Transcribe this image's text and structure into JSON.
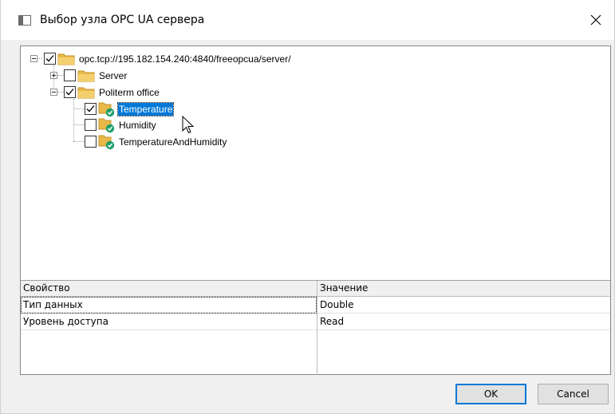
{
  "window": {
    "title": "Выбор узла OPC UA сервера"
  },
  "tree": {
    "root": {
      "label": "opc.tcp://195.182.154.240:4840/freeopcua/server/",
      "checked": true,
      "expanded": true
    },
    "server": {
      "label": "Server",
      "checked": false,
      "expanded": false
    },
    "politerm": {
      "label": "Politerm office",
      "checked": true,
      "expanded": true
    },
    "variables": [
      {
        "label": "Temperature",
        "checked": true,
        "selected": true
      },
      {
        "label": "Humidity",
        "checked": false,
        "selected": false
      },
      {
        "label": "TemperatureAndHumidity",
        "checked": false,
        "selected": false
      }
    ]
  },
  "properties": {
    "headers": {
      "property": "Свойство",
      "value": "Значение"
    },
    "rows": [
      {
        "property": "Тип данных",
        "value": "Double"
      },
      {
        "property": "Уровень доступа",
        "value": "Read"
      }
    ]
  },
  "buttons": {
    "ok": "OK",
    "cancel": "Cancel"
  },
  "colors": {
    "selection": "#0078d7",
    "folder": "#e8b84a",
    "status_ok": "#1e9e6a"
  }
}
